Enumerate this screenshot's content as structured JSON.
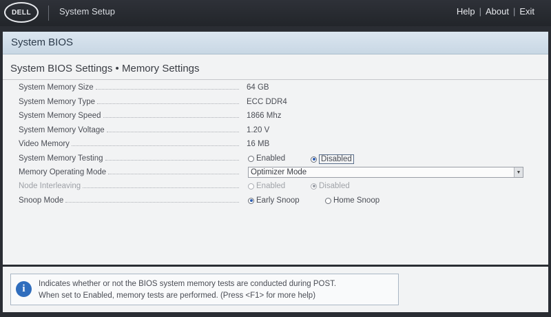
{
  "header": {
    "logo_text": "DELL",
    "app_title": "System Setup",
    "links": {
      "help": "Help",
      "about": "About",
      "exit": "Exit",
      "separator": "|"
    }
  },
  "section": {
    "title": "System BIOS"
  },
  "page": {
    "title": "System BIOS Settings • Memory Settings"
  },
  "rows": {
    "memory_size": {
      "label": "System Memory Size",
      "value": "64 GB"
    },
    "memory_type": {
      "label": "System Memory Type",
      "value": "ECC DDR4"
    },
    "memory_speed": {
      "label": "System Memory Speed",
      "value": "1866 Mhz"
    },
    "memory_voltage": {
      "label": "System Memory Voltage",
      "value": "1.20 V"
    },
    "video_memory": {
      "label": "Video Memory",
      "value": "16 MB"
    },
    "memory_testing": {
      "label": "System Memory Testing",
      "option_enabled": "Enabled",
      "option_disabled": "Disabled",
      "selected": "Disabled"
    },
    "operating_mode": {
      "label": "Memory Operating Mode",
      "value": "Optimizer Mode"
    },
    "node_interleaving": {
      "label": "Node Interleaving",
      "option_enabled": "Enabled",
      "option_disabled": "Disabled",
      "selected": "Disabled",
      "disabled": true
    },
    "snoop_mode": {
      "label": "Snoop Mode",
      "option_early": "Early Snoop",
      "option_home": "Home Snoop",
      "selected": "Early Snoop"
    }
  },
  "help": {
    "line1": "Indicates whether or not the BIOS system memory tests are conducted during POST.",
    "line2": "When set to Enabled, memory tests are performed. (Press <F1> for more help)"
  },
  "colors": {
    "header_bg": "#2a2d33",
    "section_bg": "#c8d7e4",
    "radio_selected": "#2f5fb3",
    "info_icon": "#2f6dbd"
  },
  "icons": {
    "info": "info-icon",
    "dropdown": "chevron-down-icon"
  }
}
